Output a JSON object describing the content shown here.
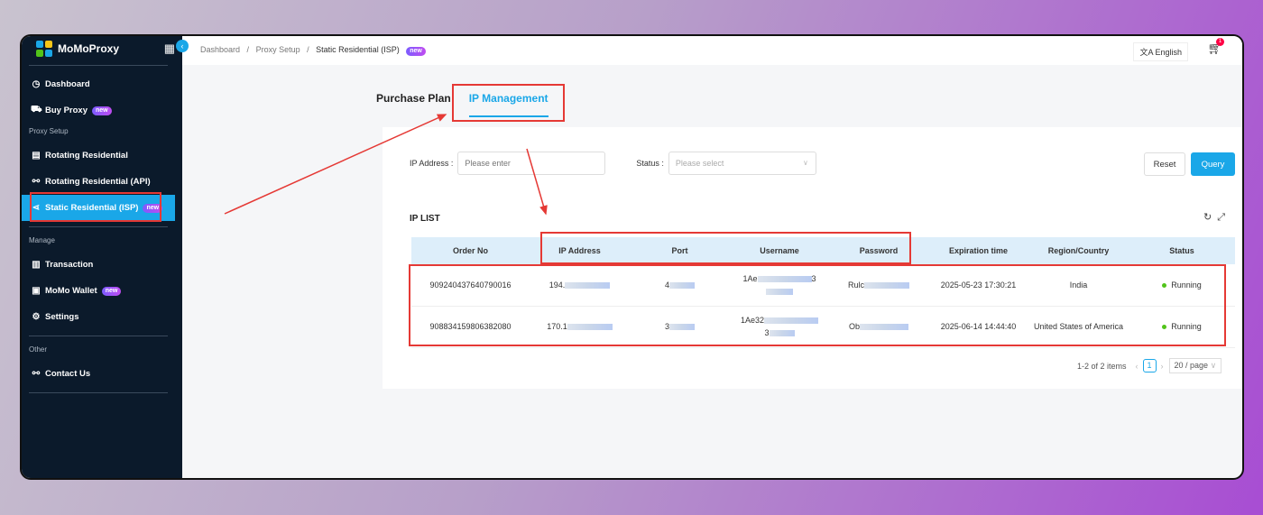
{
  "brand": {
    "name": "MoMoProxy"
  },
  "sidebar": {
    "items": [
      {
        "label": "Dashboard",
        "icon": "dashboard-icon"
      },
      {
        "label": "Buy Proxy",
        "icon": "cart-icon",
        "badge": "new"
      }
    ],
    "section_proxy": "Proxy Setup",
    "proxy_items": [
      {
        "label": "Rotating Residential"
      },
      {
        "label": "Rotating Residential (API)"
      },
      {
        "label": "Static Residential (ISP)",
        "badge": "new",
        "active": true
      }
    ],
    "section_manage": "Manage",
    "manage_items": [
      {
        "label": "Transaction"
      },
      {
        "label": "MoMo Wallet",
        "badge": "new"
      },
      {
        "label": "Settings"
      }
    ],
    "section_other": "Other",
    "other_items": [
      {
        "label": "Contact Us"
      }
    ]
  },
  "breadcrumb": {
    "a": "Dashboard",
    "b": "Proxy Setup",
    "c": "Static Residential (ISP)",
    "badge": "new"
  },
  "topbar": {
    "language": "English",
    "cart_count": "1"
  },
  "tabs": {
    "purchase": "Purchase Plan",
    "ip": "IP Management"
  },
  "filters": {
    "ip_label": "IP Address :",
    "ip_placeholder": "Please enter",
    "status_label": "Status :",
    "status_placeholder": "Please select",
    "reset": "Reset",
    "query": "Query"
  },
  "list": {
    "title": "IP LIST",
    "columns": [
      "Order No",
      "IP Address",
      "Port",
      "Username",
      "Password",
      "Expiration time",
      "Region/Country",
      "Status"
    ],
    "rows": [
      {
        "order": "909240437640790016",
        "ip": "194.",
        "port": "4",
        "user": "1Ae",
        "user2": "3",
        "pass": "Rulc",
        "exp": "2025-05-23 17:30:21",
        "region": "India",
        "status": "Running"
      },
      {
        "order": "908834159806382080",
        "ip": "170.1",
        "port": "3",
        "user": "1Ae32",
        "user2": "3",
        "pass": "Ob",
        "exp": "2025-06-14 14:44:40",
        "region": "United States of America",
        "status": "Running"
      }
    ]
  },
  "pager": {
    "summary": "1-2 of 2 items",
    "page": "1",
    "size": "20 / page"
  },
  "colors": {
    "accent": "#1aa7e8",
    "sidebar": "#0b1a2b",
    "annotation": "#e53935"
  }
}
